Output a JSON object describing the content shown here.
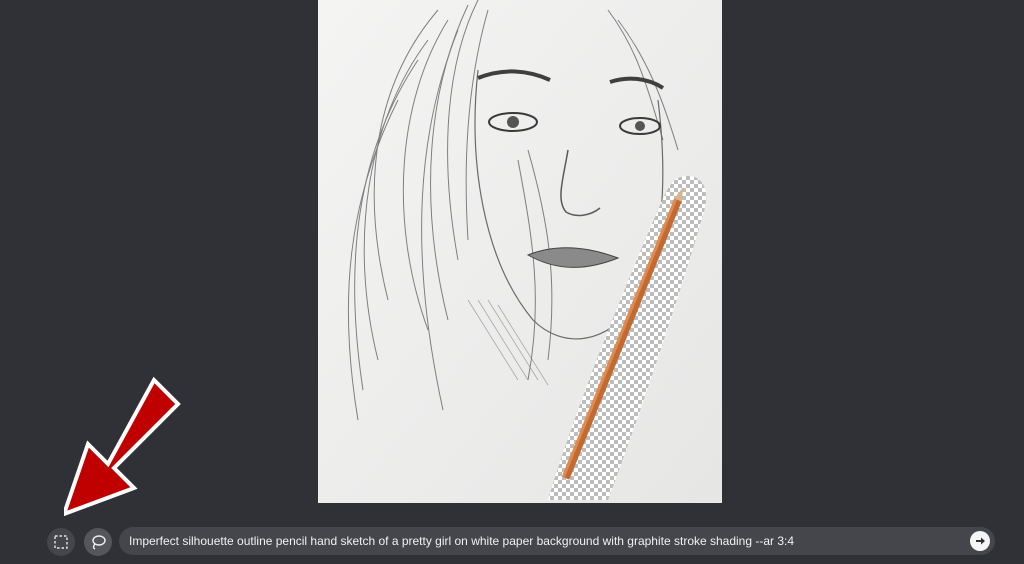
{
  "artwork": {
    "description_alt": "Pencil sketch portrait"
  },
  "toolbar": {
    "select_tool_icon": "rectangle-select-icon",
    "lasso_tool_icon": "lasso-icon"
  },
  "prompt": {
    "text_main": "Imperfect silhouette outline pencil hand sketch of a pretty girl on white paper background with graphite stroke shading ",
    "text_flag_prefix": "--",
    "text_flag": "ar",
    "text_ratio": " 3:4",
    "send_icon": "arrow-right-circle-icon"
  },
  "colors": {
    "background": "#303136",
    "input_background": "#45464c",
    "annotation_arrow": "#c00000"
  }
}
